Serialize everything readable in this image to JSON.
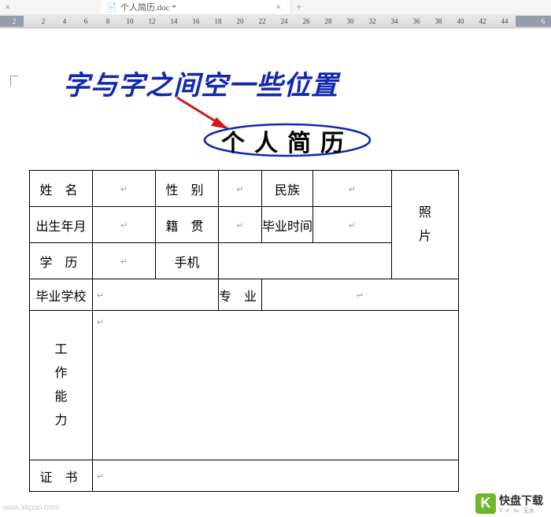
{
  "tabs": {
    "prev_close": "×",
    "doc_icon": "📄",
    "name": "个人简历.doc *",
    "close": "×",
    "new": "+"
  },
  "ruler": {
    "left": "2",
    "marks": [
      "2",
      "4",
      "6",
      "8",
      "10",
      "12",
      "14",
      "16",
      "18",
      "20",
      "22",
      "24",
      "26",
      "28",
      "30",
      "32",
      "34",
      "36",
      "38",
      "40",
      "42",
      "44"
    ],
    "right": "6"
  },
  "annotation": "字与字之间空一些位置",
  "title": "个人简历",
  "labels": {
    "name": "姓 名",
    "gender": "性 别",
    "ethnic": "民族",
    "birth": "出生年月",
    "origin": "籍 贯",
    "gradtime": "毕业时间",
    "photo1": "照",
    "photo2": "片",
    "edu": "学 历",
    "phone": "手机",
    "school": "毕业学校",
    "major": "专 业",
    "w1": "工",
    "w2": "作",
    "w3": "能",
    "w4": "力",
    "cert": "证 书"
  },
  "pm": "↵",
  "watermark": "www.kkpan.com",
  "logo": {
    "icon": "K",
    "text": "快盘下载",
    "sub": "V=8 · #a · 无水"
  }
}
